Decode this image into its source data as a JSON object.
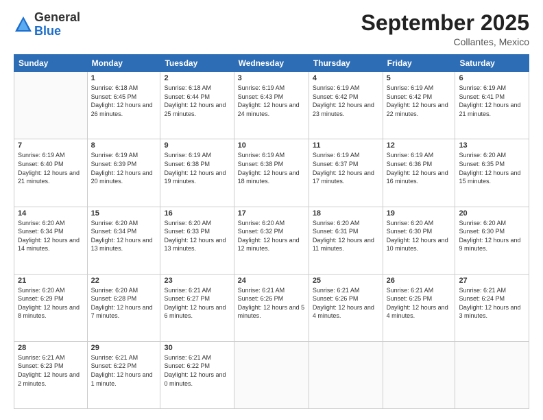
{
  "logo": {
    "general": "General",
    "blue": "Blue"
  },
  "header": {
    "month": "September 2025",
    "location": "Collantes, Mexico"
  },
  "weekdays": [
    "Sunday",
    "Monday",
    "Tuesday",
    "Wednesday",
    "Thursday",
    "Friday",
    "Saturday"
  ],
  "weeks": [
    [
      {
        "day": "",
        "sunrise": "",
        "sunset": "",
        "daylight": ""
      },
      {
        "day": "1",
        "sunrise": "Sunrise: 6:18 AM",
        "sunset": "Sunset: 6:45 PM",
        "daylight": "Daylight: 12 hours and 26 minutes."
      },
      {
        "day": "2",
        "sunrise": "Sunrise: 6:18 AM",
        "sunset": "Sunset: 6:44 PM",
        "daylight": "Daylight: 12 hours and 25 minutes."
      },
      {
        "day": "3",
        "sunrise": "Sunrise: 6:19 AM",
        "sunset": "Sunset: 6:43 PM",
        "daylight": "Daylight: 12 hours and 24 minutes."
      },
      {
        "day": "4",
        "sunrise": "Sunrise: 6:19 AM",
        "sunset": "Sunset: 6:42 PM",
        "daylight": "Daylight: 12 hours and 23 minutes."
      },
      {
        "day": "5",
        "sunrise": "Sunrise: 6:19 AM",
        "sunset": "Sunset: 6:42 PM",
        "daylight": "Daylight: 12 hours and 22 minutes."
      },
      {
        "day": "6",
        "sunrise": "Sunrise: 6:19 AM",
        "sunset": "Sunset: 6:41 PM",
        "daylight": "Daylight: 12 hours and 21 minutes."
      }
    ],
    [
      {
        "day": "7",
        "sunrise": "Sunrise: 6:19 AM",
        "sunset": "Sunset: 6:40 PM",
        "daylight": "Daylight: 12 hours and 21 minutes."
      },
      {
        "day": "8",
        "sunrise": "Sunrise: 6:19 AM",
        "sunset": "Sunset: 6:39 PM",
        "daylight": "Daylight: 12 hours and 20 minutes."
      },
      {
        "day": "9",
        "sunrise": "Sunrise: 6:19 AM",
        "sunset": "Sunset: 6:38 PM",
        "daylight": "Daylight: 12 hours and 19 minutes."
      },
      {
        "day": "10",
        "sunrise": "Sunrise: 6:19 AM",
        "sunset": "Sunset: 6:38 PM",
        "daylight": "Daylight: 12 hours and 18 minutes."
      },
      {
        "day": "11",
        "sunrise": "Sunrise: 6:19 AM",
        "sunset": "Sunset: 6:37 PM",
        "daylight": "Daylight: 12 hours and 17 minutes."
      },
      {
        "day": "12",
        "sunrise": "Sunrise: 6:19 AM",
        "sunset": "Sunset: 6:36 PM",
        "daylight": "Daylight: 12 hours and 16 minutes."
      },
      {
        "day": "13",
        "sunrise": "Sunrise: 6:20 AM",
        "sunset": "Sunset: 6:35 PM",
        "daylight": "Daylight: 12 hours and 15 minutes."
      }
    ],
    [
      {
        "day": "14",
        "sunrise": "Sunrise: 6:20 AM",
        "sunset": "Sunset: 6:34 PM",
        "daylight": "Daylight: 12 hours and 14 minutes."
      },
      {
        "day": "15",
        "sunrise": "Sunrise: 6:20 AM",
        "sunset": "Sunset: 6:34 PM",
        "daylight": "Daylight: 12 hours and 13 minutes."
      },
      {
        "day": "16",
        "sunrise": "Sunrise: 6:20 AM",
        "sunset": "Sunset: 6:33 PM",
        "daylight": "Daylight: 12 hours and 13 minutes."
      },
      {
        "day": "17",
        "sunrise": "Sunrise: 6:20 AM",
        "sunset": "Sunset: 6:32 PM",
        "daylight": "Daylight: 12 hours and 12 minutes."
      },
      {
        "day": "18",
        "sunrise": "Sunrise: 6:20 AM",
        "sunset": "Sunset: 6:31 PM",
        "daylight": "Daylight: 12 hours and 11 minutes."
      },
      {
        "day": "19",
        "sunrise": "Sunrise: 6:20 AM",
        "sunset": "Sunset: 6:30 PM",
        "daylight": "Daylight: 12 hours and 10 minutes."
      },
      {
        "day": "20",
        "sunrise": "Sunrise: 6:20 AM",
        "sunset": "Sunset: 6:30 PM",
        "daylight": "Daylight: 12 hours and 9 minutes."
      }
    ],
    [
      {
        "day": "21",
        "sunrise": "Sunrise: 6:20 AM",
        "sunset": "Sunset: 6:29 PM",
        "daylight": "Daylight: 12 hours and 8 minutes."
      },
      {
        "day": "22",
        "sunrise": "Sunrise: 6:20 AM",
        "sunset": "Sunset: 6:28 PM",
        "daylight": "Daylight: 12 hours and 7 minutes."
      },
      {
        "day": "23",
        "sunrise": "Sunrise: 6:21 AM",
        "sunset": "Sunset: 6:27 PM",
        "daylight": "Daylight: 12 hours and 6 minutes."
      },
      {
        "day": "24",
        "sunrise": "Sunrise: 6:21 AM",
        "sunset": "Sunset: 6:26 PM",
        "daylight": "Daylight: 12 hours and 5 minutes."
      },
      {
        "day": "25",
        "sunrise": "Sunrise: 6:21 AM",
        "sunset": "Sunset: 6:26 PM",
        "daylight": "Daylight: 12 hours and 4 minutes."
      },
      {
        "day": "26",
        "sunrise": "Sunrise: 6:21 AM",
        "sunset": "Sunset: 6:25 PM",
        "daylight": "Daylight: 12 hours and 4 minutes."
      },
      {
        "day": "27",
        "sunrise": "Sunrise: 6:21 AM",
        "sunset": "Sunset: 6:24 PM",
        "daylight": "Daylight: 12 hours and 3 minutes."
      }
    ],
    [
      {
        "day": "28",
        "sunrise": "Sunrise: 6:21 AM",
        "sunset": "Sunset: 6:23 PM",
        "daylight": "Daylight: 12 hours and 2 minutes."
      },
      {
        "day": "29",
        "sunrise": "Sunrise: 6:21 AM",
        "sunset": "Sunset: 6:22 PM",
        "daylight": "Daylight: 12 hours and 1 minute."
      },
      {
        "day": "30",
        "sunrise": "Sunrise: 6:21 AM",
        "sunset": "Sunset: 6:22 PM",
        "daylight": "Daylight: 12 hours and 0 minutes."
      },
      {
        "day": "",
        "sunrise": "",
        "sunset": "",
        "daylight": ""
      },
      {
        "day": "",
        "sunrise": "",
        "sunset": "",
        "daylight": ""
      },
      {
        "day": "",
        "sunrise": "",
        "sunset": "",
        "daylight": ""
      },
      {
        "day": "",
        "sunrise": "",
        "sunset": "",
        "daylight": ""
      }
    ]
  ]
}
